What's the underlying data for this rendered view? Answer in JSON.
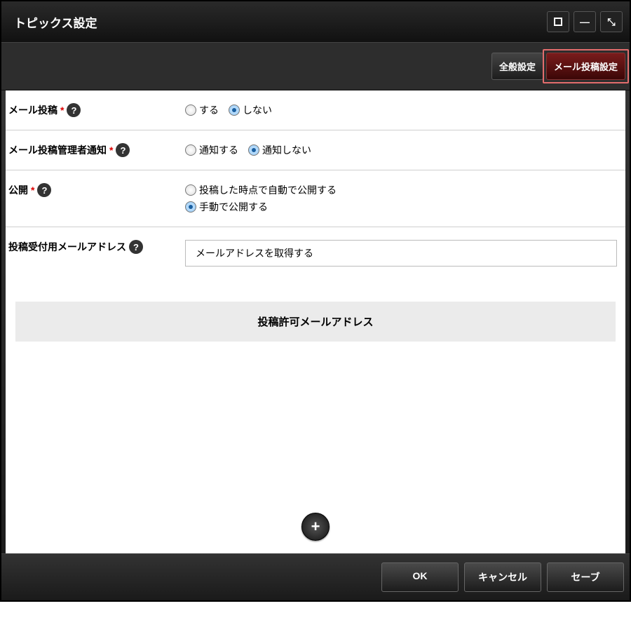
{
  "window": {
    "title": "トピックス設定"
  },
  "tabs": {
    "general": "全般設定",
    "mail": "メール投稿設定"
  },
  "rows": {
    "mail_post": {
      "label": "メール投稿",
      "required": "*",
      "opt_yes": "する",
      "opt_no": "しない"
    },
    "admin_notify": {
      "label": "メール投稿管理者通知",
      "required": "*",
      "opt_yes": "通知する",
      "opt_no": "通知しない"
    },
    "publish": {
      "label": "公開",
      "required": "*",
      "opt_auto": "投稿した時点で自動で公開する",
      "opt_manual": "手動で公開する"
    },
    "mail_addr": {
      "label": "投稿受付用メールアドレス",
      "button": "メールアドレスを取得する"
    }
  },
  "section": {
    "allowed_addresses": "投稿許可メールアドレス"
  },
  "footer": {
    "ok": "OK",
    "cancel": "キャンセル",
    "save": "セーブ"
  },
  "icons": {
    "help": "?",
    "plus": "+",
    "maximize_diag": "⤡",
    "minimize": "—"
  }
}
